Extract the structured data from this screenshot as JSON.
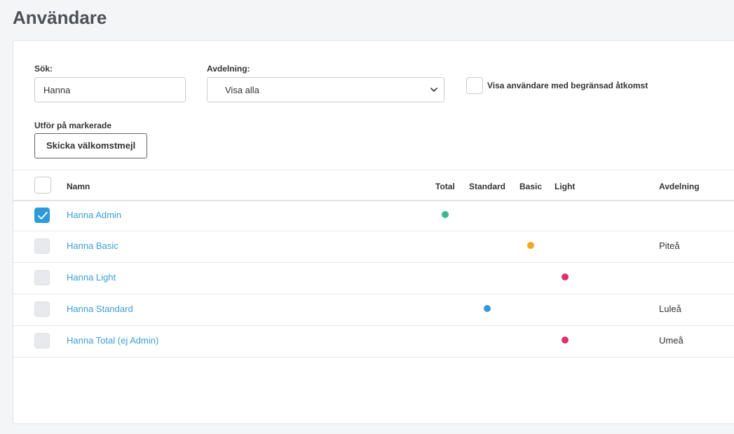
{
  "page": {
    "title": "Användare"
  },
  "filters": {
    "search_label": "Sök:",
    "search_value": "Hanna",
    "department_label": "Avdelning:",
    "department_selected": "Visa alla",
    "restricted_label": "Visa användare med begränsad åtkomst",
    "restricted_checked": false
  },
  "bulk": {
    "label": "Utför på markerade",
    "button_label": "Skicka välkomstmejl"
  },
  "table": {
    "headers": {
      "name": "Namn",
      "total": "Total",
      "standard": "Standard",
      "basic": "Basic",
      "light": "Light",
      "department": "Avdelning"
    },
    "rows": [
      {
        "name": "Hanna Admin",
        "checked": true,
        "license": "total",
        "department": ""
      },
      {
        "name": "Hanna Basic",
        "checked": false,
        "license": "basic",
        "department": "Piteå"
      },
      {
        "name": "Hanna Light",
        "checked": false,
        "license": "light",
        "department": ""
      },
      {
        "name": "Hanna Standard",
        "checked": false,
        "license": "standard",
        "department": "Luleå"
      },
      {
        "name": "Hanna Total (ej Admin)",
        "checked": false,
        "license": "light",
        "department": "Umeå"
      }
    ]
  },
  "colors": {
    "total": "#3db88a",
    "standard": "#2e9ad9",
    "basic": "#f5a623",
    "light": "#e0306a",
    "link": "#3a9fd6"
  }
}
